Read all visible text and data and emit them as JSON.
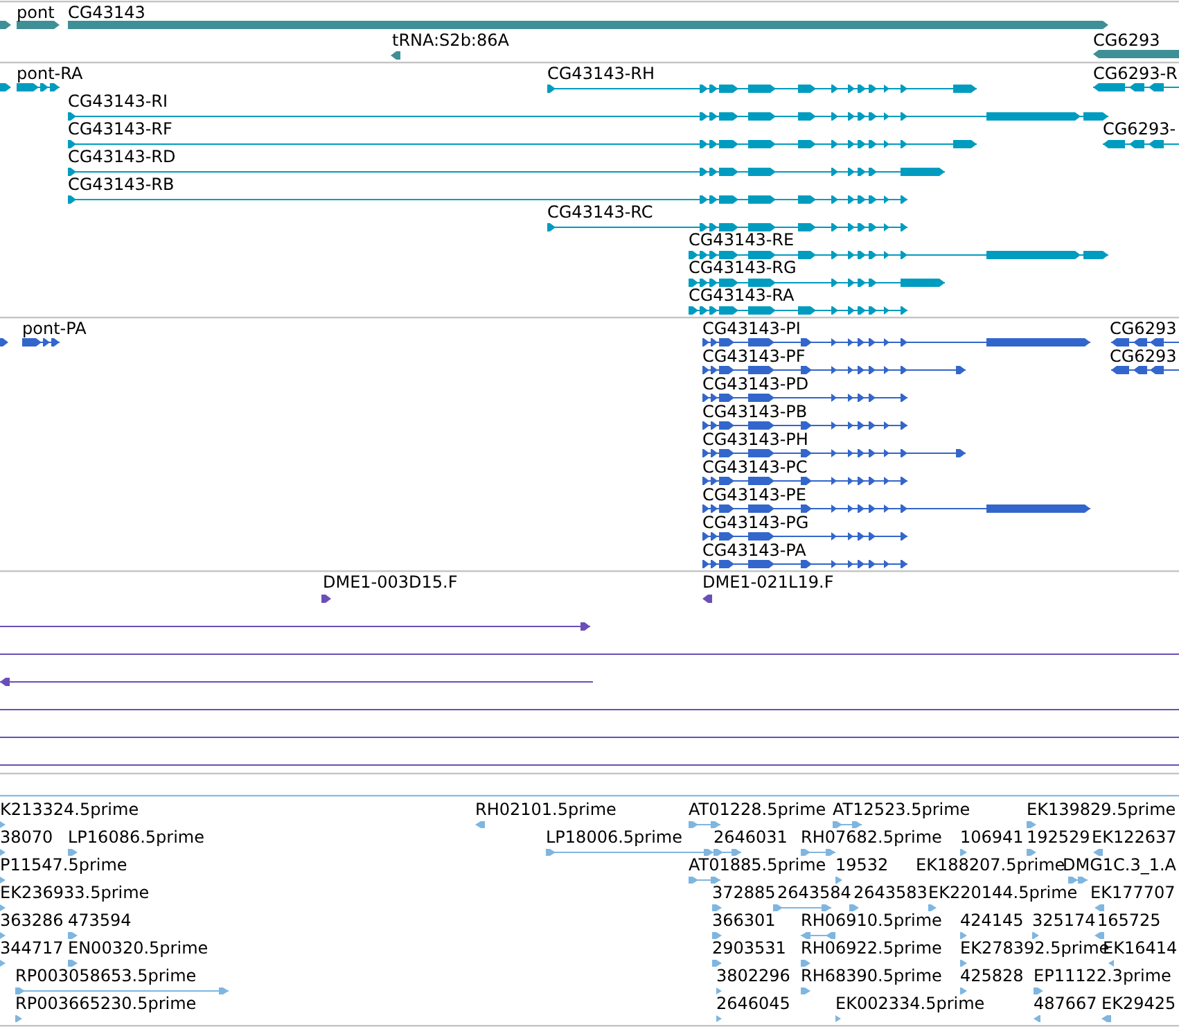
{
  "tracks": [
    {
      "color": "#3f8f96",
      "features": [
        {
          "kind": "bar",
          "reverse": false
        },
        {
          "label": "pont",
          "kind": "bar",
          "reverse": false
        },
        {
          "label": "CG43143",
          "kind": "bar",
          "reverse": false
        },
        {
          "label": "tRNA:S2b:86A",
          "kind": "bar",
          "reverse": true
        },
        {
          "label": "CG6293",
          "kind": "bar",
          "reverse": true
        }
      ]
    },
    {
      "color": "#009cc0",
      "features": [
        {
          "kind": "bar",
          "reverse": false
        },
        {
          "label": "pont-RA",
          "kind": "transcript",
          "reverse": false
        },
        {
          "label": "CG43143-RH",
          "kind": "transcript",
          "reverse": false
        },
        {
          "label": "CG6293-R",
          "kind": "transcript",
          "reverse": true
        },
        {
          "label": "CG43143-RI",
          "kind": "transcript",
          "reverse": false
        },
        {
          "label": "CG6293-",
          "kind": "transcript",
          "reverse": true
        },
        {
          "label": "CG43143-RF",
          "kind": "transcript",
          "reverse": false
        },
        {
          "label": "CG43143-RD",
          "kind": "transcript",
          "reverse": false
        },
        {
          "label": "CG43143-RB",
          "kind": "transcript",
          "reverse": false
        },
        {
          "label": "CG43143-RC",
          "kind": "transcript",
          "reverse": false
        },
        {
          "label": "CG43143-RE",
          "kind": "transcript",
          "reverse": false
        },
        {
          "label": "CG43143-RG",
          "kind": "transcript",
          "reverse": false
        },
        {
          "label": "CG43143-RA",
          "kind": "transcript",
          "reverse": false
        }
      ]
    },
    {
      "color": "#3366cc",
      "features": [
        {
          "kind": "bar",
          "reverse": false
        },
        {
          "label": "pont-PA",
          "kind": "transcript",
          "reverse": false
        },
        {
          "label": "CG43143-PI",
          "kind": "transcript",
          "reverse": false
        },
        {
          "label": "CG6293",
          "kind": "transcript",
          "reverse": true
        },
        {
          "label": "CG43143-PF",
          "kind": "transcript",
          "reverse": false
        },
        {
          "label": "CG6293",
          "kind": "transcript",
          "reverse": true
        },
        {
          "label": "CG43143-PD",
          "kind": "transcript",
          "reverse": false
        },
        {
          "label": "CG43143-PB",
          "kind": "transcript",
          "reverse": false
        },
        {
          "label": "CG43143-PH",
          "kind": "transcript",
          "reverse": false
        },
        {
          "label": "CG43143-PC",
          "kind": "transcript",
          "reverse": false
        },
        {
          "label": "CG43143-PE",
          "kind": "transcript",
          "reverse": false
        },
        {
          "label": "CG43143-PG",
          "kind": "transcript",
          "reverse": false
        },
        {
          "label": "CG43143-PA",
          "kind": "transcript",
          "reverse": false
        }
      ]
    },
    {
      "color": "#6a4fb8",
      "features": [
        {
          "label": "DME1-003D15.F",
          "kind": "read",
          "reverse": false
        },
        {
          "label": "DME1-021L19.F",
          "kind": "read",
          "reverse": true
        },
        {
          "kind": "read",
          "reverse": false
        },
        {
          "kind": "read"
        },
        {
          "kind": "read",
          "reverse": true
        },
        {
          "kind": "read"
        },
        {
          "kind": "read"
        },
        {
          "kind": "read"
        }
      ]
    },
    {
      "color": "#7fb6e0",
      "features": [
        {
          "label": "K213324.5prime",
          "kind": "est",
          "reverse": false
        },
        {
          "label": "RH02101.5prime",
          "kind": "est",
          "reverse": true
        },
        {
          "label": "AT01228.5prime",
          "kind": "est",
          "reverse": false
        },
        {
          "label": "AT12523.5prime",
          "kind": "est",
          "reverse": false
        },
        {
          "label": "EK139829.5prime",
          "kind": "est",
          "reverse": false
        },
        {
          "label": "38070",
          "kind": "est",
          "reverse": false
        },
        {
          "label": "LP16086.5prime",
          "kind": "est",
          "reverse": false
        },
        {
          "label": "LP18006.5prime",
          "kind": "est",
          "reverse": false
        },
        {
          "label": "2646031",
          "kind": "est",
          "reverse": false
        },
        {
          "label": "RH07682.5prime",
          "kind": "est",
          "reverse": false
        },
        {
          "label": "106941",
          "kind": "est",
          "reverse": false
        },
        {
          "label": "192529",
          "kind": "est",
          "reverse": false
        },
        {
          "label": "EK122637",
          "kind": "est",
          "reverse": true
        },
        {
          "label": "P11547.5prime",
          "kind": "est",
          "reverse": false
        },
        {
          "label": "AT01885.5prime",
          "kind": "est",
          "reverse": false
        },
        {
          "label": "19532",
          "kind": "est",
          "reverse": false
        },
        {
          "label": "EK188207.5prime",
          "kind": "est"
        },
        {
          "label": "DMG1C.3_1.A",
          "kind": "est",
          "reverse": false
        },
        {
          "label": "EK236933.5prime",
          "kind": "est",
          "reverse": false
        },
        {
          "label": "372885",
          "kind": "est",
          "reverse": false
        },
        {
          "label": "2643584",
          "kind": "est",
          "reverse": false
        },
        {
          "label": "2643583",
          "kind": "est",
          "reverse": false
        },
        {
          "label": "EK220144.5prime",
          "kind": "est",
          "reverse": false
        },
        {
          "label": "EK177707",
          "kind": "est",
          "reverse": true
        },
        {
          "label": "363286",
          "kind": "est",
          "reverse": false
        },
        {
          "label": "473594",
          "kind": "est",
          "reverse": false
        },
        {
          "label": "366301",
          "kind": "est",
          "reverse": false
        },
        {
          "label": "RH06910.5prime",
          "kind": "est",
          "reverse": true
        },
        {
          "label": "424145",
          "kind": "est",
          "reverse": false
        },
        {
          "label": "325174",
          "kind": "est",
          "reverse": false
        },
        {
          "label": "165725",
          "kind": "est",
          "reverse": true
        },
        {
          "label": "344717",
          "kind": "est",
          "reverse": false
        },
        {
          "label": "EN00320.5prime",
          "kind": "est",
          "reverse": false
        },
        {
          "label": "2903531",
          "kind": "est",
          "reverse": false
        },
        {
          "label": "RH06922.5prime",
          "kind": "est",
          "reverse": false
        },
        {
          "label": "EK278392.5prime",
          "kind": "est",
          "reverse": false
        },
        {
          "label": "EK16414",
          "kind": "est",
          "reverse": true
        },
        {
          "label": "RP003058653.5prime",
          "kind": "est",
          "reverse": false
        },
        {
          "label": "3802296",
          "kind": "est",
          "reverse": false
        },
        {
          "label": "RH68390.5prime",
          "kind": "est",
          "reverse": false
        },
        {
          "label": "425828",
          "kind": "est",
          "reverse": false
        },
        {
          "label": "EP11122.3prime",
          "kind": "est",
          "reverse": false
        },
        {
          "label": "RP003665230.5prime",
          "kind": "est",
          "reverse": false
        },
        {
          "label": "2646045",
          "kind": "est",
          "reverse": false
        },
        {
          "label": "EK002334.5prime",
          "kind": "est",
          "reverse": false
        },
        {
          "label": "487667",
          "kind": "est",
          "reverse": true
        },
        {
          "label": "EK29425",
          "kind": "est",
          "reverse": true
        }
      ]
    }
  ]
}
